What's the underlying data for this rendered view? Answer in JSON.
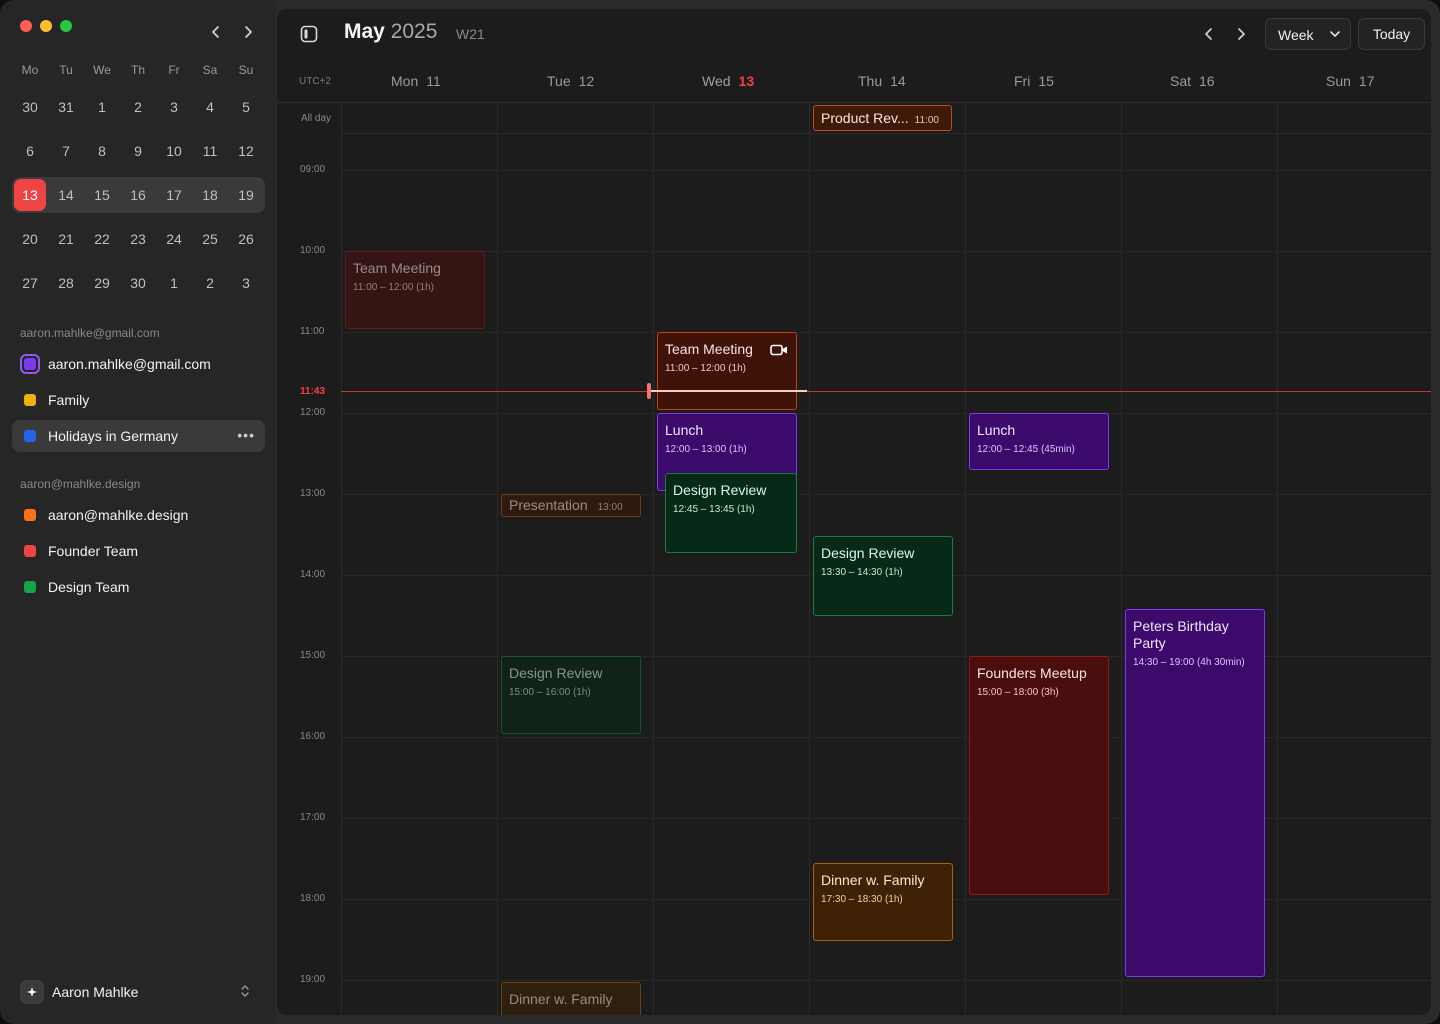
{
  "mini_calendar": {
    "weekday_headers": [
      "Mo",
      "Tu",
      "We",
      "Th",
      "Fr",
      "Sa",
      "Su"
    ],
    "weeks": [
      [
        "30",
        "31",
        "1",
        "2",
        "3",
        "4",
        "5"
      ],
      [
        "6",
        "7",
        "8",
        "9",
        "10",
        "11",
        "12"
      ],
      [
        "13",
        "14",
        "15",
        "16",
        "17",
        "18",
        "19"
      ],
      [
        "20",
        "21",
        "22",
        "23",
        "24",
        "25",
        "26"
      ],
      [
        "27",
        "28",
        "29",
        "30",
        "1",
        "2",
        "3"
      ]
    ],
    "today": "13"
  },
  "accounts": [
    {
      "label": "aaron.mahlke@gmail.com",
      "calendars": [
        {
          "name": "aaron.mahlke@gmail.com",
          "color": "#7c3aed"
        },
        {
          "name": "Family",
          "color": "#eab308"
        },
        {
          "name": "Holidays in Germany",
          "color": "#2563eb"
        }
      ]
    },
    {
      "label": "aaron@mahlke.design",
      "calendars": [
        {
          "name": "aaron@mahlke.design",
          "color": "#f97316"
        },
        {
          "name": "Founder Team",
          "color": "#ef4444"
        },
        {
          "name": "Design Team",
          "color": "#16a34a"
        }
      ]
    }
  ],
  "user": {
    "name": "Aaron Mahlke"
  },
  "header": {
    "month": "May",
    "year": "2025",
    "week": "W21",
    "view": "Week",
    "today_label": "Today"
  },
  "grid": {
    "timezone": "UTC+2",
    "allday_label": "All day",
    "days": [
      {
        "name": "Mon",
        "num": "11"
      },
      {
        "name": "Tue",
        "num": "12"
      },
      {
        "name": "Wed",
        "num": "13"
      },
      {
        "name": "Thu",
        "num": "14"
      },
      {
        "name": "Fri",
        "num": "15"
      },
      {
        "name": "Sat",
        "num": "16"
      },
      {
        "name": "Sun",
        "num": "17"
      }
    ],
    "hours": [
      "09:00",
      "10:00",
      "11:00",
      "12:00",
      "13:00",
      "14:00",
      "15:00",
      "16:00",
      "17:00",
      "18:00",
      "19:00"
    ],
    "now": "11:43"
  },
  "events": {
    "product_review": {
      "title": "Product Rev...",
      "time": "11:00"
    },
    "mon_team_meeting": {
      "title": "Team Meeting",
      "time": "11:00 – 12:00 (1h)"
    },
    "wed_team_meeting": {
      "title": "Team Meeting",
      "time": "11:00 – 12:00 (1h)"
    },
    "wed_lunch": {
      "title": "Lunch",
      "time": "12:00 – 13:00 (1h)"
    },
    "wed_design_review": {
      "title": "Design Review",
      "time": "12:45 – 13:45 (1h)"
    },
    "fri_lunch": {
      "title": "Lunch",
      "time": "12:00 – 12:45 (45min)"
    },
    "tue_presentation": {
      "title": "Presentation",
      "time": "13:00"
    },
    "thu_design_review": {
      "title": "Design Review",
      "time": "13:30 – 14:30 (1h)"
    },
    "tue_design_review": {
      "title": "Design Review",
      "time": "15:00 – 16:00 (1h)"
    },
    "sat_birthday": {
      "title": "Peters Birthday Party",
      "time": "14:30 – 19:00 (4h 30min)"
    },
    "fri_founders": {
      "title": "Founders Meetup",
      "time": "15:00 – 18:00 (3h)"
    },
    "thu_dinner": {
      "title": "Dinner w. Family",
      "time": "17:30 – 18:30 (1h)"
    },
    "tue_dinner": {
      "title": "Dinner w. Family"
    }
  }
}
